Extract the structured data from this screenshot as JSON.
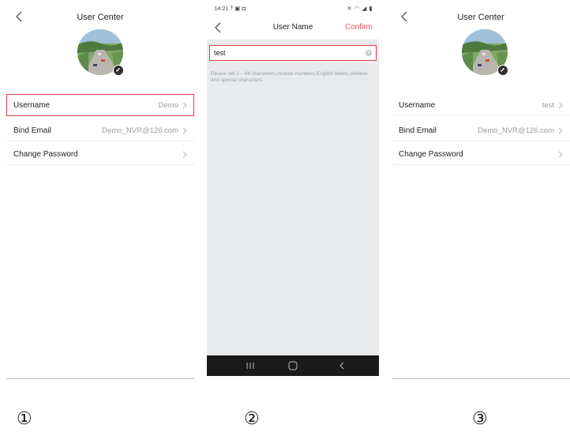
{
  "screen1": {
    "title": "User Center",
    "rows": [
      {
        "label": "Username",
        "value": "Demo"
      },
      {
        "label": "Bind Email",
        "value": "Demo_NVR@126.com"
      },
      {
        "label": "Change Password",
        "value": ""
      }
    ]
  },
  "screen2": {
    "status_time": "14:21",
    "status_icons_left": "⤒ ▣ ◘",
    "status_icons_right": "✕ ◠ ◢ ▮",
    "title": "User Name",
    "confirm_label": "Confirm",
    "input_value": "test",
    "hint": "Please set 2 – 64 characters,include numbers,English letters,chinese and special characters.",
    "highlight_color": "#d9434c",
    "accent_color": "#f2545b"
  },
  "screen3": {
    "title": "User Center",
    "rows": [
      {
        "label": "Username",
        "value": "test"
      },
      {
        "label": "Bind Email",
        "value": "Demo_NVR@126.com"
      },
      {
        "label": "Change Password",
        "value": ""
      }
    ]
  },
  "step_labels": [
    "①",
    "②",
    "③"
  ]
}
